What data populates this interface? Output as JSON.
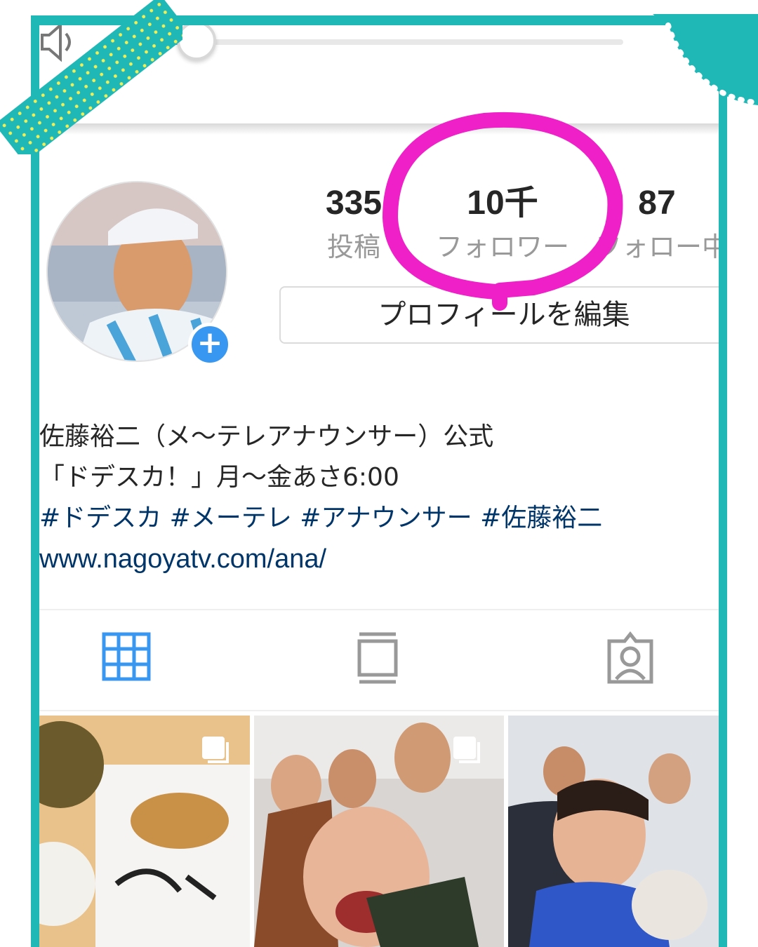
{
  "profile": {
    "stats": [
      {
        "value": "335",
        "label": "投稿"
      },
      {
        "value": "10千",
        "label": "フォロワー"
      },
      {
        "value": "87",
        "label": "フォロー中"
      }
    ],
    "edit_button": "プロフィールを編集",
    "add_symbol": "+"
  },
  "bio": {
    "name_line": "佐藤裕二（メ〜テレアナウンサー）公式",
    "schedule_line": "「ドデスカ！」月〜金あさ6:00",
    "hashtags": "#ドデスカ #メーテレ #アナウンサー #佐藤裕二",
    "link": "www.nagoyatv.com/ana/"
  },
  "tabs": [
    {
      "icon": "grid-icon",
      "active": true
    },
    {
      "icon": "feed-icon",
      "active": false
    },
    {
      "icon": "tagged-person-icon",
      "active": false
    }
  ],
  "posts": [
    {
      "icon": "carousel-icon"
    },
    {
      "icon": "carousel-icon"
    },
    {
      "icon": "none"
    }
  ],
  "colors": {
    "frame": "#20b8b6",
    "highlight": "#f020c8",
    "accent": "#3897f0",
    "hashtag": "#003569"
  }
}
